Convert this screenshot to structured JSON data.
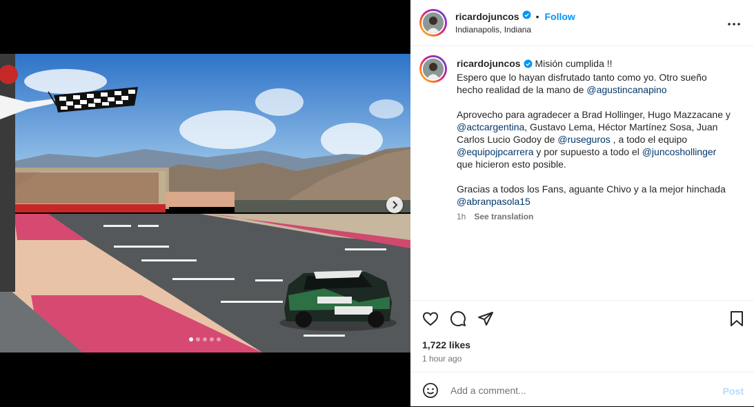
{
  "post": {
    "author": "ricardojuncos",
    "follow_label": "Follow",
    "separator": "•",
    "location": "Indianapolis, Indiana",
    "caption": {
      "author": "ricardojuncos",
      "line1": "Misión cumplida !!",
      "p1_text": "Espero que lo hayan disfrutado tanto como yo. Otro sueño hecho realidad de la mano de ",
      "p1_mention": "@agustincanapino",
      "p2_a": "Aprovecho para agradecer a Brad Hollinger, Hugo Mazzacane y ",
      "p2_m1": "@actcargentina",
      "p2_b": ", Gustavo Lema, Héctor Martínez Sosa, Juan Carlos Lucio Godoy de ",
      "p2_m2": "@ruseguros",
      "p2_c": " , a todo el equipo ",
      "p2_m3": "@equipojpcarrera",
      "p2_d": " y por supuesto a todo el ",
      "p2_m4": "@juncoshollinger",
      "p2_e": " que hicieron esto posible.",
      "p3_text": "Gracias a todos los Fans, aguante Chivo y a la mejor hinchada ",
      "p3_mention": "@abranpasola15"
    },
    "caption_time": "1h",
    "see_translation": "See translation",
    "likes": "1,722 likes",
    "posted": "1 hour ago",
    "comment_placeholder": "Add a comment...",
    "post_label": "Post",
    "carousel": {
      "total": 5,
      "active": 1
    },
    "colors": {
      "accent": "#0095f6",
      "mention": "#00376b",
      "post_disabled": "#b3dbff"
    }
  }
}
